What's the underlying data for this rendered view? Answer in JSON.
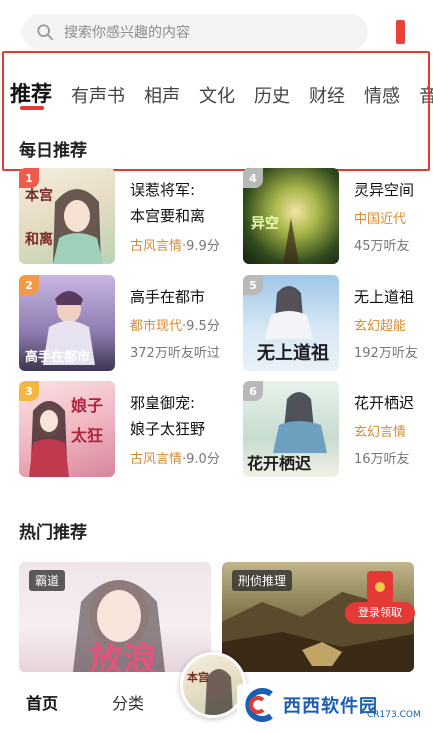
{
  "search": {
    "placeholder": "搜索你感兴趣的内容"
  },
  "tabs": [
    "推荐",
    "有声书",
    "相声",
    "文化",
    "历史",
    "财经",
    "情感",
    "音"
  ],
  "daily": {
    "title": "每日推荐",
    "books": [
      {
        "rank": "1",
        "title_line1": "误惹将军:",
        "title_line2": "本宫要和离",
        "genre": "古风言情",
        "score": "·9.9分",
        "cover_text": "本宫要和离"
      },
      {
        "rank": "2",
        "title": "高手在都市",
        "genre": "都市现代",
        "score": "·9.5分",
        "meta": "372万听友听过",
        "cover_text": "高手在都市"
      },
      {
        "rank": "3",
        "title_line1": "邪皇御宠:",
        "title_line2": "娘子太狂野",
        "genre": "古风言情",
        "score": "·9.0分",
        "cover_text": "娘子太狂野"
      },
      {
        "rank": "4",
        "title": "灵异空间",
        "genre": "中国近代",
        "meta": "45万听友",
        "cover_text": "异空间"
      },
      {
        "rank": "5",
        "title": "无上道祖",
        "genre": "玄幻超能",
        "meta": "192万听友",
        "cover_text": "无上道祖"
      },
      {
        "rank": "6",
        "title": "花开栖迟",
        "genre": "玄幻言情",
        "meta": "16万听友",
        "cover_text": "花开栖迟"
      }
    ]
  },
  "hot": {
    "title": "热门推荐",
    "cards": [
      {
        "tag": "霸道",
        "text": "放浪"
      },
      {
        "tag": "刑侦推理",
        "text": ""
      }
    ]
  },
  "floating": {
    "label": "登录领取"
  },
  "bottom_nav": {
    "home": "首页",
    "category": "分类"
  },
  "watermark": {
    "text": "西西软件园",
    "sub": "CR173.COM"
  },
  "colors": {
    "accent": "#e53935",
    "tag": "#d98c2e"
  }
}
